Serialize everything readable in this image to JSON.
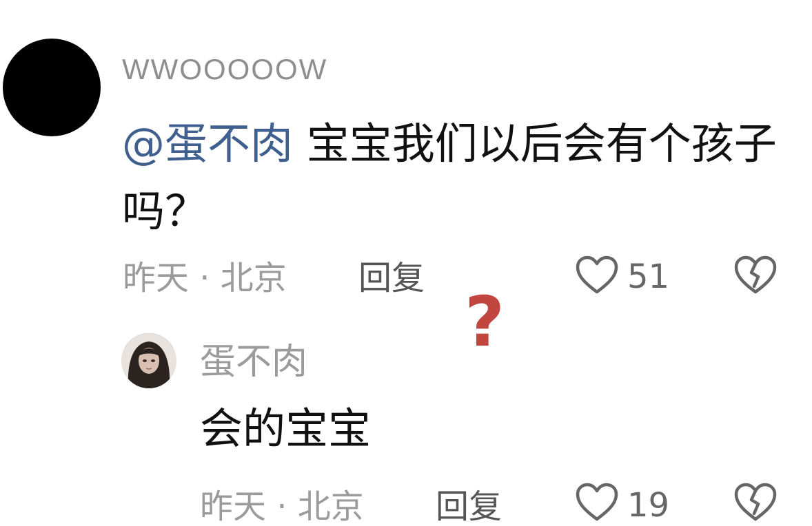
{
  "main_comment": {
    "username": "WWOOOOOW",
    "mention": "@蛋不肉",
    "text": " 宝宝我们以后会有个孩子吗？",
    "time_location": "昨天 · 北京",
    "reply_label": "回复",
    "like_count": "51",
    "like_icon": "heart-outline-icon",
    "dislike_icon": "broken-heart-icon"
  },
  "reply_comment": {
    "username": "蛋不肉",
    "text": "会的宝宝",
    "time_location": "昨天 · 北京",
    "reply_label": "回复",
    "like_count": "19",
    "like_icon": "heart-outline-icon",
    "dislike_icon": "broken-heart-icon"
  },
  "overlay": {
    "symbol": "?",
    "color": "#c0463f"
  }
}
